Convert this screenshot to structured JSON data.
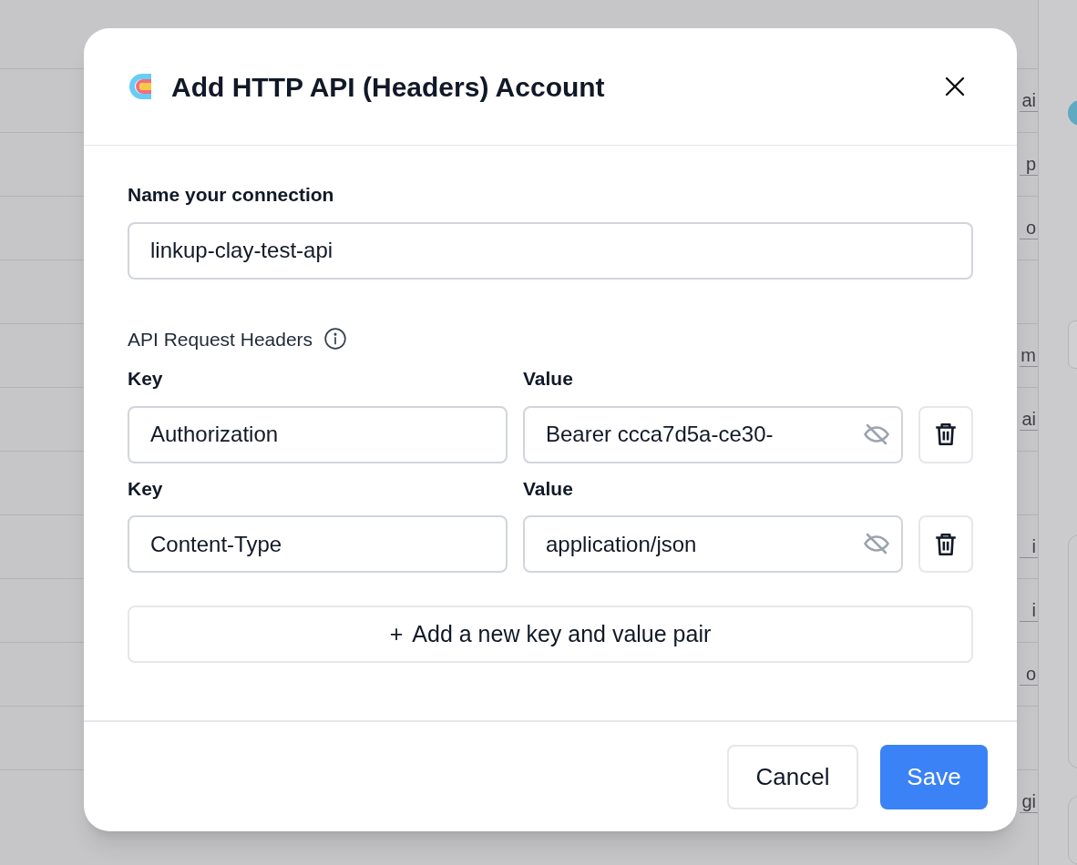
{
  "background": {
    "table_rows": [
      {
        "empty": false,
        "cell": "ai"
      },
      {
        "empty": false,
        "cell": "p"
      },
      {
        "empty": false,
        "cell": "o"
      },
      {
        "empty": true
      },
      {
        "empty": false,
        "cell": "m"
      },
      {
        "empty": false,
        "cell": "ai"
      },
      {
        "empty": true
      },
      {
        "empty": false,
        "cell": "i"
      },
      {
        "empty": false,
        "cell": "i"
      },
      {
        "empty": false,
        "cell": "o"
      },
      {
        "empty": true
      },
      {
        "empty": false,
        "cell": "gi"
      }
    ]
  },
  "dialog": {
    "title": "Add HTTP API (Headers) Account",
    "name_field": {
      "label": "Name your connection",
      "value": "linkup-clay-test-api"
    },
    "headers_section": {
      "label": "API Request Headers",
      "rows": [
        {
          "key_label": "Key",
          "key": "Authorization",
          "value_label": "Value",
          "value": "Bearer ccca7d5a-ce30-"
        },
        {
          "key_label": "Key",
          "key": "Content-Type",
          "value_label": "Value",
          "value": "application/json"
        }
      ]
    },
    "add_button": {
      "icon": "+",
      "label": "Add a new key and value pair"
    },
    "buttons": [
      {
        "label": "Cancel",
        "kind": "secondary"
      },
      {
        "label": "Save",
        "kind": "primary"
      }
    ]
  }
}
